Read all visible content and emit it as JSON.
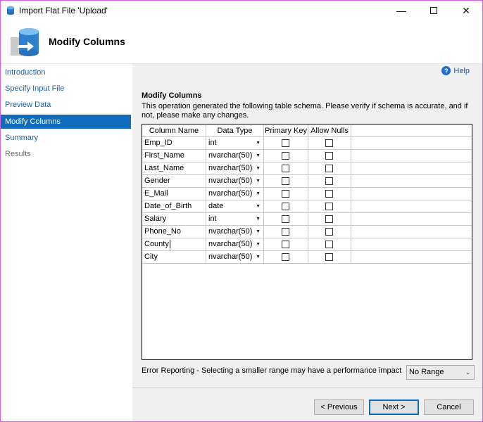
{
  "window": {
    "title": "Import Flat File 'Upload'"
  },
  "banner": {
    "title": "Modify Columns"
  },
  "sidebar": {
    "items": [
      {
        "label": "Introduction",
        "state": "link"
      },
      {
        "label": "Specify Input File",
        "state": "link"
      },
      {
        "label": "Preview Data",
        "state": "link"
      },
      {
        "label": "Modify Columns",
        "state": "active"
      },
      {
        "label": "Summary",
        "state": "link"
      },
      {
        "label": "Results",
        "state": "disabled"
      }
    ]
  },
  "help": {
    "label": "Help"
  },
  "main": {
    "section_title": "Modify Columns",
    "description": "This operation generated the following table schema. Please verify if schema is accurate, and if not, please make any changes."
  },
  "grid": {
    "headers": {
      "name": "Column Name",
      "type": "Data Type",
      "pk": "Primary Key",
      "nulls": "Allow Nulls"
    },
    "rows": [
      {
        "name": "Emp_ID",
        "type": "int",
        "pk": false,
        "nulls": false
      },
      {
        "name": "First_Name",
        "type": "nvarchar(50)",
        "pk": false,
        "nulls": false
      },
      {
        "name": "Last_Name",
        "type": "nvarchar(50)",
        "pk": false,
        "nulls": false
      },
      {
        "name": "Gender",
        "type": "nvarchar(50)",
        "pk": false,
        "nulls": false
      },
      {
        "name": "E_Mail",
        "type": "nvarchar(50)",
        "pk": false,
        "nulls": false
      },
      {
        "name": "Date_of_Birth",
        "type": "date",
        "pk": false,
        "nulls": false
      },
      {
        "name": "Salary",
        "type": "int",
        "pk": false,
        "nulls": false
      },
      {
        "name": "Phone_No",
        "type": "nvarchar(50)",
        "pk": false,
        "nulls": false
      },
      {
        "name": "County",
        "type": "nvarchar(50)",
        "pk": false,
        "nulls": false
      },
      {
        "name": "City",
        "type": "nvarchar(50)",
        "pk": false,
        "nulls": false
      }
    ]
  },
  "error_reporting": {
    "label": "Error Reporting - Selecting a smaller range may have a performance impact",
    "selected": "No Range"
  },
  "buttons": {
    "previous": "< Previous",
    "next": "Next >",
    "cancel": "Cancel"
  },
  "icons": {
    "app": "database-icon",
    "banner": "database-import-icon",
    "help": "help-icon",
    "minimize": "minimize-icon",
    "maximize": "maximize-icon",
    "close": "close-icon"
  },
  "colors": {
    "accent": "#0f6cbd",
    "link": "#1f5fa8",
    "border": "#d25de6"
  }
}
